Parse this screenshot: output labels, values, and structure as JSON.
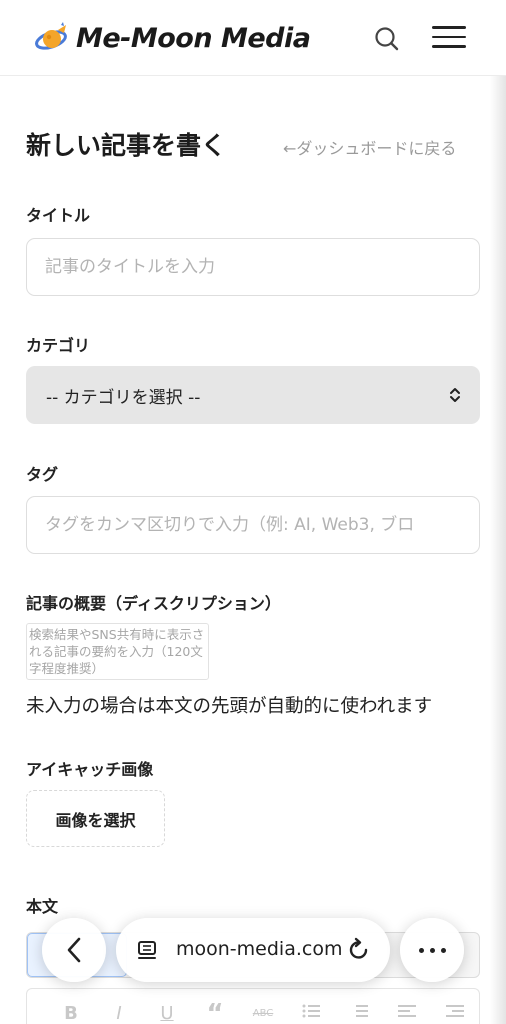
{
  "header": {
    "logo_text": "Me-Moon Media",
    "logo_icon": "moon-rocket-logo-icon",
    "search_icon": "search-icon",
    "menu_icon": "hamburger-menu-icon"
  },
  "page": {
    "title": "新しい記事を書く",
    "back_link": "←ダッシュボードに戻る"
  },
  "form": {
    "title_label": "タイトル",
    "title_placeholder": "記事のタイトルを入力",
    "title_value": "",
    "category_label": "カテゴリ",
    "category_selected": "-- カテゴリを選択 --",
    "tags_label": "タグ",
    "tags_placeholder": "タグをカンマ区切りで入力（例: AI, Web3, ブロ",
    "tags_value": "",
    "description_label": "記事の概要（ディスクリプション）",
    "description_placeholder": "検索結果やSNS共有時に表示される記事の要約を入力（120文字程度推奨）",
    "description_hint": "未入力の場合は本文の先頭が自動的に使われます",
    "eyecatch_label": "アイキャッチ画像",
    "eyecatch_button": "画像を選択",
    "body_label": "本文"
  },
  "editor_toolbar": {
    "bold": "B",
    "italic": "I",
    "underline": "U",
    "quote": "“",
    "strike": "ABC"
  },
  "browser_bar": {
    "url": "moon-media.com",
    "back_icon": "chevron-left-icon",
    "reader_icon": "reader-mode-icon",
    "reload_icon": "reload-icon",
    "more_icon": "more-dots-icon"
  },
  "colors": {
    "accent_orange": "#f4a52a",
    "accent_blue": "#4a7bd8",
    "select_bg": "#e6e6e6",
    "placeholder": "#b3b3b3"
  }
}
